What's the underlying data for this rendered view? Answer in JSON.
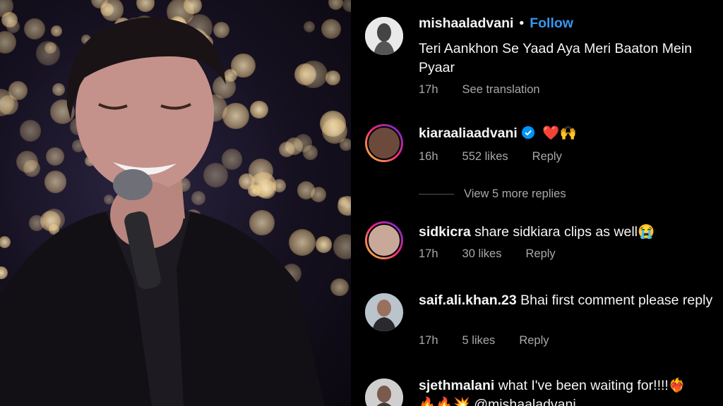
{
  "post": {
    "username": "mishaaladvani",
    "follow_label": "Follow",
    "separator": "•",
    "caption": "Teri Aankhon Se Yaad Aya Meri Baaton Mein Pyaar",
    "time": "17h",
    "see_translation": "See translation"
  },
  "comments": [
    {
      "username": "kiaraaliaadvani",
      "text": "❤️🙌",
      "time": "16h",
      "likes": "552 likes",
      "reply": "Reply"
    },
    {
      "username": "sidkicra",
      "text": "share sidkiara clips as well😭",
      "time": "17h",
      "likes": "30 likes",
      "reply": "Reply"
    },
    {
      "username": "saif.ali.khan.23",
      "text": "Bhai first comment please reply",
      "time": "17h",
      "likes": "5 likes",
      "reply": "Reply"
    },
    {
      "username": "sjethmalani",
      "text": "what I've been waiting for!!!!❤️‍🔥",
      "text2": "🔥🔥💥 @mishaaladvani"
    }
  ],
  "view_more_replies": "View 5 more replies",
  "colors": {
    "link": "#3797f0",
    "secondary_text": "#a8a8a8",
    "verified": "#0095f6"
  }
}
